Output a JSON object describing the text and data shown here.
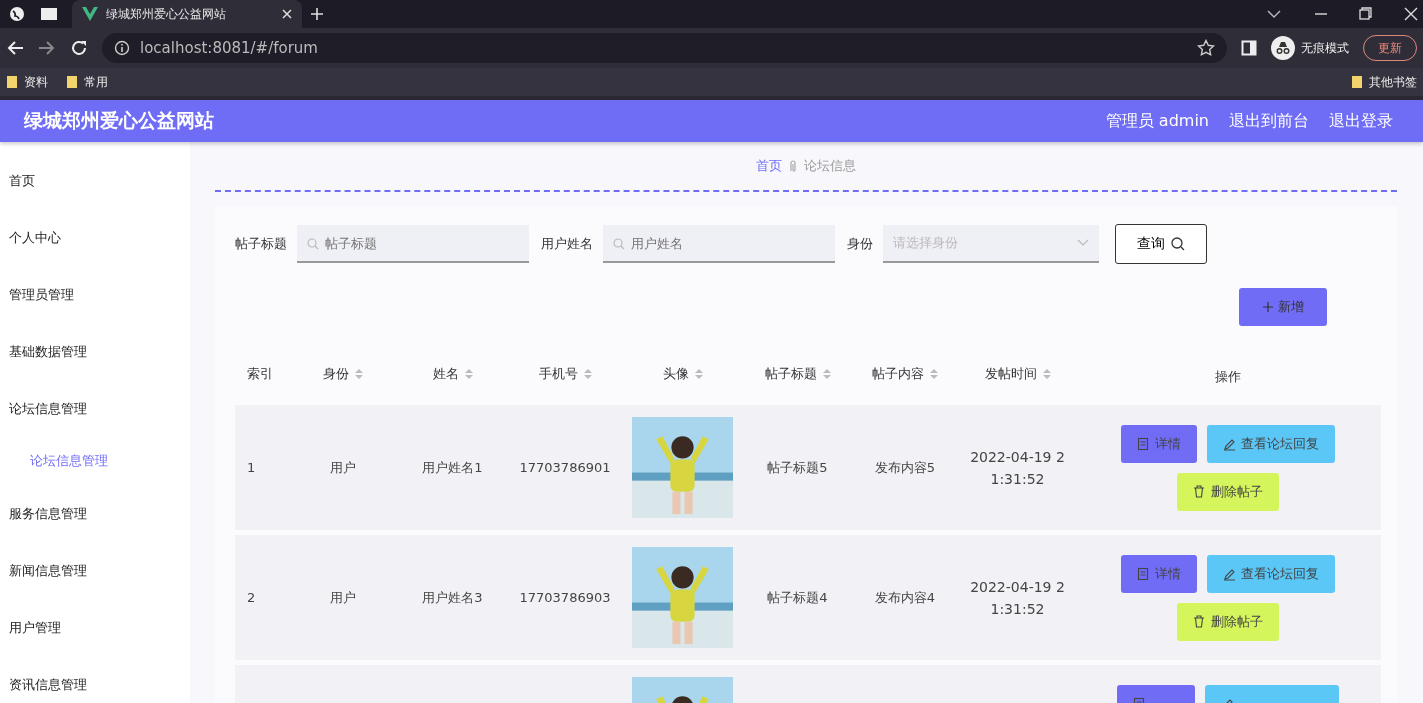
{
  "browser": {
    "tabs": [
      {
        "title": "绿城郑州爱心公益网站"
      }
    ],
    "url": "localhost:8081/#/forum",
    "profile_label": "无痕模式",
    "update_button": "更新",
    "bookmarks": [
      "资料",
      "常用"
    ],
    "other_bookmarks": "其他书签"
  },
  "header": {
    "title": "绿城郑州爱心公益网站",
    "links": [
      "管理员 admin",
      "退出到前台",
      "退出登录"
    ]
  },
  "sidebar": {
    "items": [
      {
        "label": "首页",
        "selected": false
      },
      {
        "label": "个人中心",
        "selected": false
      },
      {
        "label": "管理员管理",
        "selected": false
      },
      {
        "label": "基础数据管理",
        "selected": false
      },
      {
        "label": "论坛信息管理",
        "selected": false,
        "children": [
          {
            "label": "论坛信息管理",
            "selected": true
          }
        ]
      },
      {
        "label": "服务信息管理",
        "selected": false
      },
      {
        "label": "新闻信息管理",
        "selected": false
      },
      {
        "label": "用户管理",
        "selected": false
      },
      {
        "label": "资讯信息管理",
        "selected": false
      }
    ]
  },
  "breadcrumb": [
    "首页",
    "论坛信息"
  ],
  "filters": [
    {
      "label": "帖子标题",
      "kind": "input",
      "placeholder": "帖子标题"
    },
    {
      "label": "用户姓名",
      "kind": "input",
      "placeholder": "用户姓名"
    },
    {
      "label": "身份",
      "kind": "select",
      "placeholder": "请选择身份"
    }
  ],
  "search_button": "查询",
  "add_button": "新增",
  "table": {
    "columns": [
      "索引",
      "身份",
      "姓名",
      "手机号",
      "头像",
      "帖子标题",
      "帖子内容",
      "发帖时间",
      "操作"
    ],
    "rows": [
      {
        "index": "1",
        "role": "用户",
        "name": "用户姓名1",
        "phone": "17703786901",
        "avatar": {
          "kind": "picture"
        },
        "title": "帖子标题5",
        "content": "发布内容5",
        "time": "2022-04-19 21:31:52",
        "actions": [
          {
            "kind": "detail",
            "label": "详情"
          },
          {
            "kind": "reply",
            "label": "查看论坛回复"
          },
          {
            "kind": "delete",
            "label": "删除帖子"
          }
        ]
      },
      {
        "index": "2",
        "role": "用户",
        "name": "用户姓名3",
        "phone": "17703786903",
        "avatar": {
          "kind": "picture"
        },
        "title": "帖子标题4",
        "content": "发布内容4",
        "time": "2022-04-19 21:31:52",
        "actions": [
          {
            "kind": "detail",
            "label": "详情"
          },
          {
            "kind": "reply",
            "label": "查看论坛回复"
          },
          {
            "kind": "delete",
            "label": "删除帖子"
          }
        ]
      },
      {
        "avatar": {
          "kind": "picture"
        },
        "actions": [
          {
            "kind": "detail"
          },
          {
            "kind": "reply"
          }
        ]
      }
    ]
  }
}
